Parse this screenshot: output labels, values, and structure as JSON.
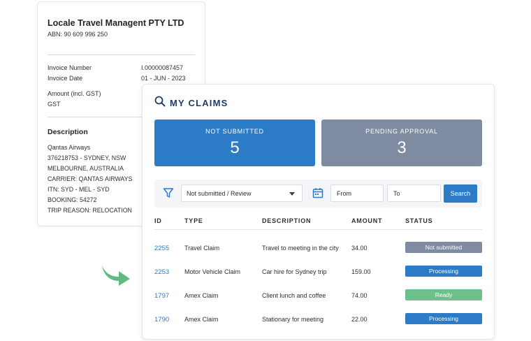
{
  "invoice": {
    "company": "Locale Travel Managent PTY LTD",
    "abn": "ABN: 90 609 996 250",
    "invoice_number_label": "Invoice Number",
    "invoice_number_value": "I.00000087457",
    "invoice_date_label": "Invoice Date",
    "invoice_date_value": "01 - JUN  -  2023",
    "amount_label": "Amount (incl. GST)",
    "gst_label": "GST",
    "description_title": "Description",
    "description_lines": [
      "Qantas Airways",
      "376218753 - SYDNEY, NSW",
      "MELBOURNE, AUSTRALIA",
      "CARRIER: QANTAS AIRWAYS",
      "ITN: SYD - MEL - SYD",
      "BOOKING: 54272",
      "TRIP REASON: RELOCATION"
    ]
  },
  "claims": {
    "title": "MY CLAIMS",
    "stats": {
      "not_submitted_label": "NOT SUBMITTED",
      "not_submitted_count": "5",
      "pending_label": "PENDING APPROVAL",
      "pending_count": "3"
    },
    "filter": {
      "status_select": "Not submitted / Review",
      "from_placeholder": "From",
      "to_placeholder": "To",
      "search_label": "Search"
    },
    "columns": {
      "id": "ID",
      "type": "TYPE",
      "description": "DESCRIPTION",
      "amount": "AMOUNT",
      "status": "STATUS"
    },
    "rows": [
      {
        "id": "2255",
        "type": "Travel Claim",
        "description": "Travel to meeting in the city",
        "amount": "34.00",
        "status": "Not submitted"
      },
      {
        "id": "2253",
        "type": "Motor Vehicle Claim",
        "description": "Car hire for Sydney trip",
        "amount": "159.00",
        "status": "Processing"
      },
      {
        "id": "1797",
        "type": "Amex Claim",
        "description": "Client lunch and coffee",
        "amount": "74.00",
        "status": "Ready"
      },
      {
        "id": "1790",
        "type": "Amex Claim",
        "description": "Stationary for meeting",
        "amount": "22.00",
        "status": "Processing"
      }
    ]
  },
  "colors": {
    "primary": "#2b7bc6",
    "gray_status": "#7f8ba0",
    "ready": "#6cc08b",
    "title_navy": "#1f3b6e",
    "arrow_green": "#5fba84"
  },
  "icons": {
    "search": "search-icon",
    "filter": "filter-icon",
    "calendar": "calendar-icon",
    "arrow": "curved-arrow-icon"
  }
}
